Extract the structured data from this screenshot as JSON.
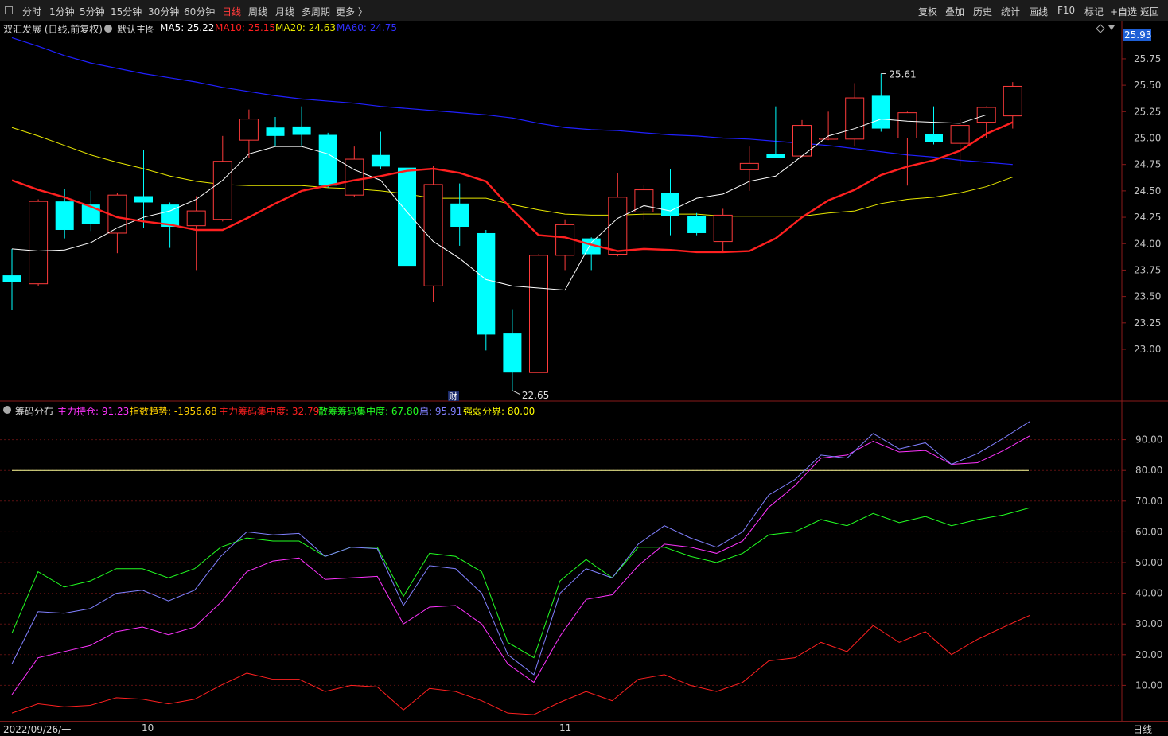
{
  "toolbar": {
    "periods": [
      "分时",
      "1分钟",
      "5分钟",
      "15分钟",
      "30分钟",
      "60分钟",
      "日线",
      "周线",
      "月线",
      "多周期",
      "更多 〉"
    ],
    "active": "日线",
    "right_buttons": [
      "复权",
      "叠加",
      "历史",
      "统计",
      "画线",
      "F10",
      "标记",
      "+自选",
      "返回"
    ]
  },
  "main_chart": {
    "title": "双汇发展 (日线,前复权)",
    "indicator_name": "默认主图",
    "ma5_label": "MA5: 25.22",
    "ma10_label": "MA10: 25.15",
    "ma20_label": "MA20: 24.63",
    "ma60_label": "MA60: 24.75",
    "current_price": "25.93",
    "high_label": "25.61",
    "low_label": "22.65",
    "fin_marker": "财",
    "colors": {
      "up": "#ff3b3b",
      "down": "#00ffff",
      "ma5": "#ffffff",
      "ma10": "#ff2020",
      "ma20": "#e8e800",
      "ma60": "#2020ff"
    },
    "y_ticks": [
      "25.75",
      "25.50",
      "25.25",
      "25.00",
      "24.75",
      "24.50",
      "24.25",
      "24.00",
      "23.75",
      "23.50",
      "23.25",
      "23.00"
    ]
  },
  "chart_data": [
    {
      "type": "candlestick",
      "title": "双汇发展 (日线,前复权)",
      "ylim": [
        22.5,
        25.93
      ],
      "candles": [
        {
          "o": 23.7,
          "h": 23.95,
          "l": 23.37,
          "c": 23.64
        },
        {
          "o": 23.62,
          "h": 24.42,
          "l": 23.6,
          "c": 24.4
        },
        {
          "o": 24.4,
          "h": 24.52,
          "l": 24.05,
          "c": 24.13
        },
        {
          "o": 24.37,
          "h": 24.5,
          "l": 24.12,
          "c": 24.19
        },
        {
          "o": 24.1,
          "h": 24.48,
          "l": 23.91,
          "c": 24.46
        },
        {
          "o": 24.45,
          "h": 24.89,
          "l": 24.15,
          "c": 24.39
        },
        {
          "o": 24.37,
          "h": 24.39,
          "l": 23.96,
          "c": 24.16
        },
        {
          "o": 24.17,
          "h": 24.45,
          "l": 23.75,
          "c": 24.31
        },
        {
          "o": 24.23,
          "h": 25.02,
          "l": 24.21,
          "c": 24.78
        },
        {
          "o": 24.98,
          "h": 25.27,
          "l": 24.81,
          "c": 25.18
        },
        {
          "o": 25.1,
          "h": 25.2,
          "l": 24.92,
          "c": 25.02
        },
        {
          "o": 25.11,
          "h": 25.3,
          "l": 24.93,
          "c": 25.03
        },
        {
          "o": 25.03,
          "h": 25.05,
          "l": 24.53,
          "c": 24.55
        },
        {
          "o": 24.46,
          "h": 24.92,
          "l": 24.44,
          "c": 24.8
        },
        {
          "o": 24.84,
          "h": 25.06,
          "l": 24.71,
          "c": 24.73
        },
        {
          "o": 24.72,
          "h": 24.91,
          "l": 23.67,
          "c": 23.79
        },
        {
          "o": 23.6,
          "h": 24.74,
          "l": 23.45,
          "c": 24.56
        },
        {
          "o": 24.38,
          "h": 24.57,
          "l": 23.98,
          "c": 24.16
        },
        {
          "o": 24.1,
          "h": 24.13,
          "l": 22.99,
          "c": 23.14
        },
        {
          "o": 23.15,
          "h": 23.38,
          "l": 22.61,
          "c": 22.78
        },
        {
          "o": 22.78,
          "h": 23.9,
          "l": 22.78,
          "c": 23.89
        },
        {
          "o": 23.89,
          "h": 24.23,
          "l": 23.75,
          "c": 24.18
        },
        {
          "o": 24.05,
          "h": 24.06,
          "l": 23.75,
          "c": 23.9
        },
        {
          "o": 23.9,
          "h": 24.67,
          "l": 23.88,
          "c": 24.44
        },
        {
          "o": 24.3,
          "h": 24.56,
          "l": 24.22,
          "c": 24.51
        },
        {
          "o": 24.48,
          "h": 24.71,
          "l": 24.08,
          "c": 24.26
        },
        {
          "o": 24.26,
          "h": 24.29,
          "l": 24.08,
          "c": 24.1
        },
        {
          "o": 24.02,
          "h": 24.33,
          "l": 23.93,
          "c": 24.27
        },
        {
          "o": 24.7,
          "h": 24.92,
          "l": 24.5,
          "c": 24.76
        },
        {
          "o": 24.85,
          "h": 25.3,
          "l": 24.82,
          "c": 24.81
        },
        {
          "o": 24.83,
          "h": 25.17,
          "l": 24.82,
          "c": 25.12
        },
        {
          "o": 25.0,
          "h": 25.25,
          "l": 24.98,
          "c": 25.0
        },
        {
          "o": 24.99,
          "h": 25.52,
          "l": 24.92,
          "c": 25.38
        },
        {
          "o": 25.4,
          "h": 25.61,
          "l": 25.06,
          "c": 25.09
        },
        {
          "o": 25.0,
          "h": 25.25,
          "l": 24.55,
          "c": 25.24
        },
        {
          "o": 25.04,
          "h": 25.3,
          "l": 24.94,
          "c": 24.96
        },
        {
          "o": 24.95,
          "h": 25.18,
          "l": 24.73,
          "c": 25.12
        },
        {
          "o": 25.15,
          "h": 25.3,
          "l": 25.0,
          "c": 25.29
        },
        {
          "o": 25.21,
          "h": 25.53,
          "l": 25.09,
          "c": 25.49
        }
      ],
      "ma5": [
        23.95,
        23.93,
        23.94,
        24.01,
        24.15,
        24.25,
        24.31,
        24.42,
        24.6,
        24.85,
        24.92,
        24.92,
        24.85,
        24.7,
        24.6,
        24.3,
        24.02,
        23.86,
        23.66,
        23.6,
        23.58,
        23.56,
        24.01,
        24.24,
        24.36,
        24.31,
        24.43,
        24.47,
        24.59,
        24.64,
        24.83,
        25.02,
        25.09,
        25.18,
        25.16,
        25.15,
        25.14,
        25.22
      ],
      "ma10": [
        24.6,
        24.51,
        24.44,
        24.35,
        24.25,
        24.21,
        24.18,
        24.13,
        24.13,
        24.25,
        24.38,
        24.5,
        24.55,
        24.6,
        24.64,
        24.69,
        24.71,
        24.67,
        24.59,
        24.32,
        24.08,
        24.06,
        23.99,
        23.93,
        23.95,
        23.94,
        23.92,
        23.92,
        23.93,
        24.05,
        24.25,
        24.41,
        24.51,
        24.65,
        24.73,
        24.79,
        24.88,
        25.04,
        25.15
      ],
      "ma20": [
        25.1,
        25.02,
        24.93,
        24.84,
        24.77,
        24.71,
        24.64,
        24.59,
        24.56,
        24.55,
        24.55,
        24.55,
        24.53,
        24.52,
        24.5,
        24.47,
        24.43,
        24.43,
        24.43,
        24.37,
        24.32,
        24.28,
        24.27,
        24.27,
        24.28,
        24.28,
        24.28,
        24.26,
        24.26,
        24.26,
        24.26,
        24.29,
        24.31,
        24.38,
        24.42,
        24.44,
        24.48,
        24.54,
        24.63
      ],
      "ma60": [
        25.95,
        25.87,
        25.78,
        25.71,
        25.66,
        25.61,
        25.57,
        25.53,
        25.48,
        25.44,
        25.4,
        25.37,
        25.35,
        25.33,
        25.3,
        25.28,
        25.26,
        25.24,
        25.22,
        25.19,
        25.14,
        25.1,
        25.08,
        25.07,
        25.05,
        25.03,
        25.02,
        25.0,
        24.99,
        24.97,
        24.95,
        24.93,
        24.9,
        24.87,
        24.84,
        24.82,
        24.79,
        24.77,
        24.75
      ]
    },
    {
      "type": "line",
      "title": "筹码分布",
      "ylim": [
        0,
        100
      ],
      "series": [
        {
          "name": "主力持仓",
          "values": [
            7,
            19,
            21,
            23,
            27.5,
            29,
            26.5,
            29,
            37,
            47,
            50.5,
            51.5,
            44.5,
            45,
            45.5,
            30,
            35.5,
            36,
            30,
            17,
            11,
            26,
            38,
            39.5,
            49,
            56,
            55,
            53,
            57,
            68,
            75,
            84,
            85,
            89.5,
            86,
            86.5,
            82,
            82.5,
            86.5,
            91.23
          ]
        },
        {
          "name": "指数趋势",
          "values": [
            27,
            47,
            42,
            44,
            48,
            48,
            45,
            48,
            55,
            58,
            57,
            57,
            52,
            55,
            55,
            39,
            53,
            52,
            47,
            24,
            19,
            44,
            51,
            45,
            55,
            55,
            52,
            50,
            53,
            59,
            60,
            64,
            62,
            66,
            63,
            65,
            62,
            64,
            65.5,
            67.8
          ]
        },
        {
          "name": "主力筹码集中度",
          "values": [
            1,
            4,
            3,
            3.5,
            6,
            5.5,
            4,
            5.5,
            10,
            14,
            12,
            12,
            8,
            10,
            9.5,
            2,
            9,
            8,
            5,
            1,
            0.5,
            4.5,
            8,
            5,
            12,
            13.5,
            10,
            8,
            11,
            18,
            19,
            24,
            21,
            29.5,
            24,
            27.5,
            20,
            25,
            29,
            32.79
          ]
        },
        {
          "name": "散筹筹码集中度",
          "values": [
            17,
            34,
            33.5,
            35,
            40,
            41,
            37.5,
            41,
            52,
            60,
            59,
            59.5,
            52,
            55,
            54.5,
            36,
            49,
            48,
            40,
            20,
            13.5,
            40,
            48,
            45,
            56,
            62,
            58,
            55,
            60,
            72,
            77,
            85,
            84,
            92,
            87,
            89,
            82,
            85.5,
            90.5,
            95.91
          ]
        }
      ],
      "threshold": 80
    }
  ],
  "indicator_panel": {
    "name": "筹码分布",
    "legend": [
      {
        "label": "主力持仓: 91.23",
        "color": "#ff33ff"
      },
      {
        "label": "指数趋势: -1956.68",
        "color": "#ffd000"
      },
      {
        "label": "主力筹码集中度: 32.79",
        "color": "#ff2020"
      },
      {
        "label": "散筹筹码集中度: 67.80",
        "color": "#22ff22"
      },
      {
        "label": "启: 95.91",
        "color": "#8080ff"
      },
      {
        "label": "强弱分界: 80.00",
        "color": "#ffff00"
      }
    ],
    "y_ticks": [
      "90.00",
      "80.00",
      "70.00",
      "60.00",
      "50.00",
      "40.00",
      "30.00",
      "20.00",
      "10.00"
    ]
  },
  "bottom": {
    "date": "2022/09/26/一",
    "month1": "10",
    "month2": "11",
    "period": "日线"
  }
}
